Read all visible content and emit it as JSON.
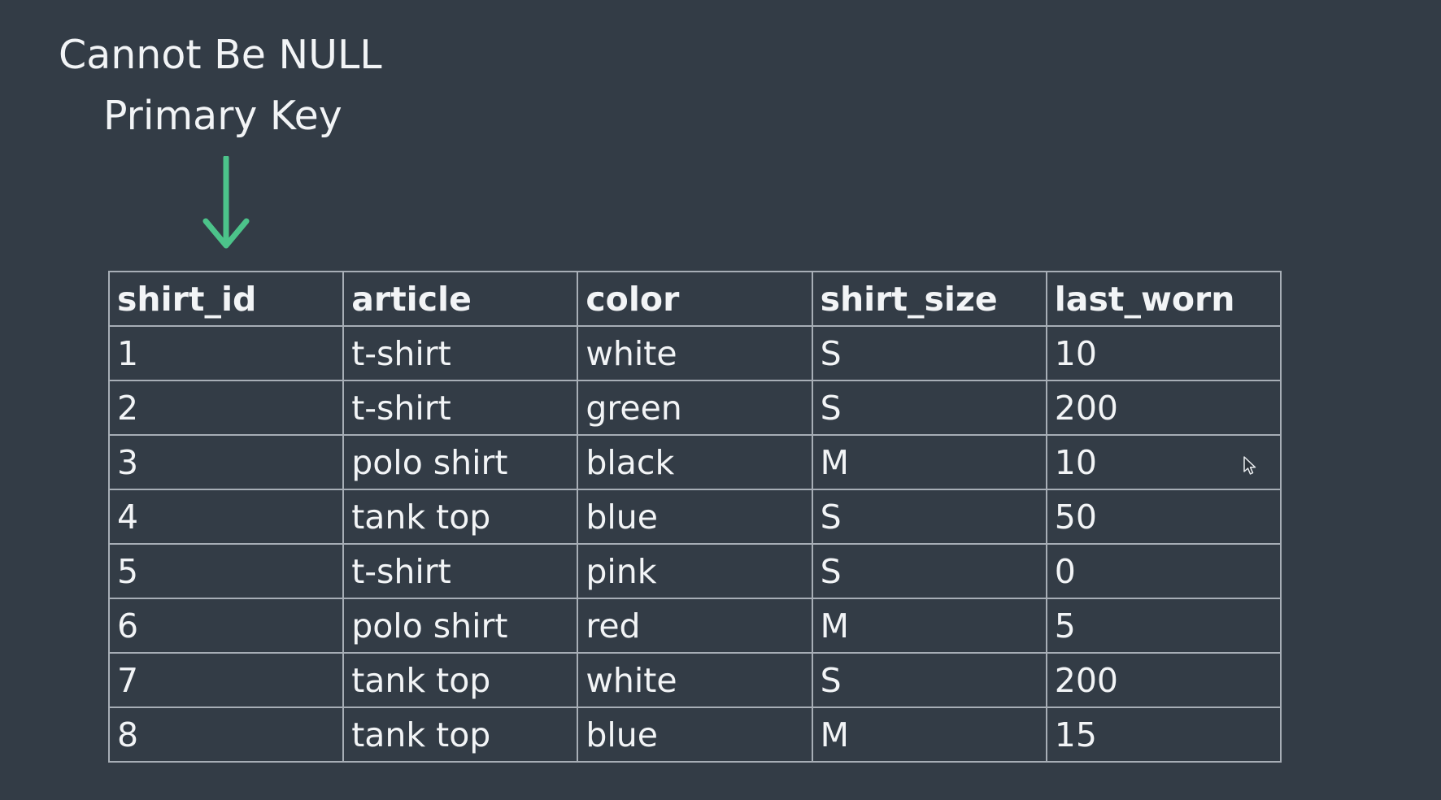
{
  "caption": {
    "line1": "Cannot Be NULL",
    "line2": "Primary Key",
    "arrow_color": "#4cc38a",
    "arrow_icon": "arrow-down-icon"
  },
  "table": {
    "columns": [
      "shirt_id",
      "article",
      "color",
      "shirt_size",
      "last_worn"
    ],
    "rows": [
      [
        "1",
        "t-shirt",
        "white",
        "S",
        "10"
      ],
      [
        "2",
        "t-shirt",
        "green",
        "S",
        "200"
      ],
      [
        "3",
        "polo shirt",
        "black",
        "M",
        "10"
      ],
      [
        "4",
        "tank top",
        "blue",
        "S",
        "50"
      ],
      [
        "5",
        "t-shirt",
        "pink",
        "S",
        "0"
      ],
      [
        "6",
        "polo shirt",
        "red",
        "M",
        "5"
      ],
      [
        "7",
        "tank top",
        "white",
        "S",
        "200"
      ],
      [
        "8",
        "tank top",
        "blue",
        "M",
        "15"
      ]
    ]
  },
  "colors": {
    "background": "#333c46",
    "text": "#f2f4f6",
    "grid": "#a7aeb6"
  }
}
